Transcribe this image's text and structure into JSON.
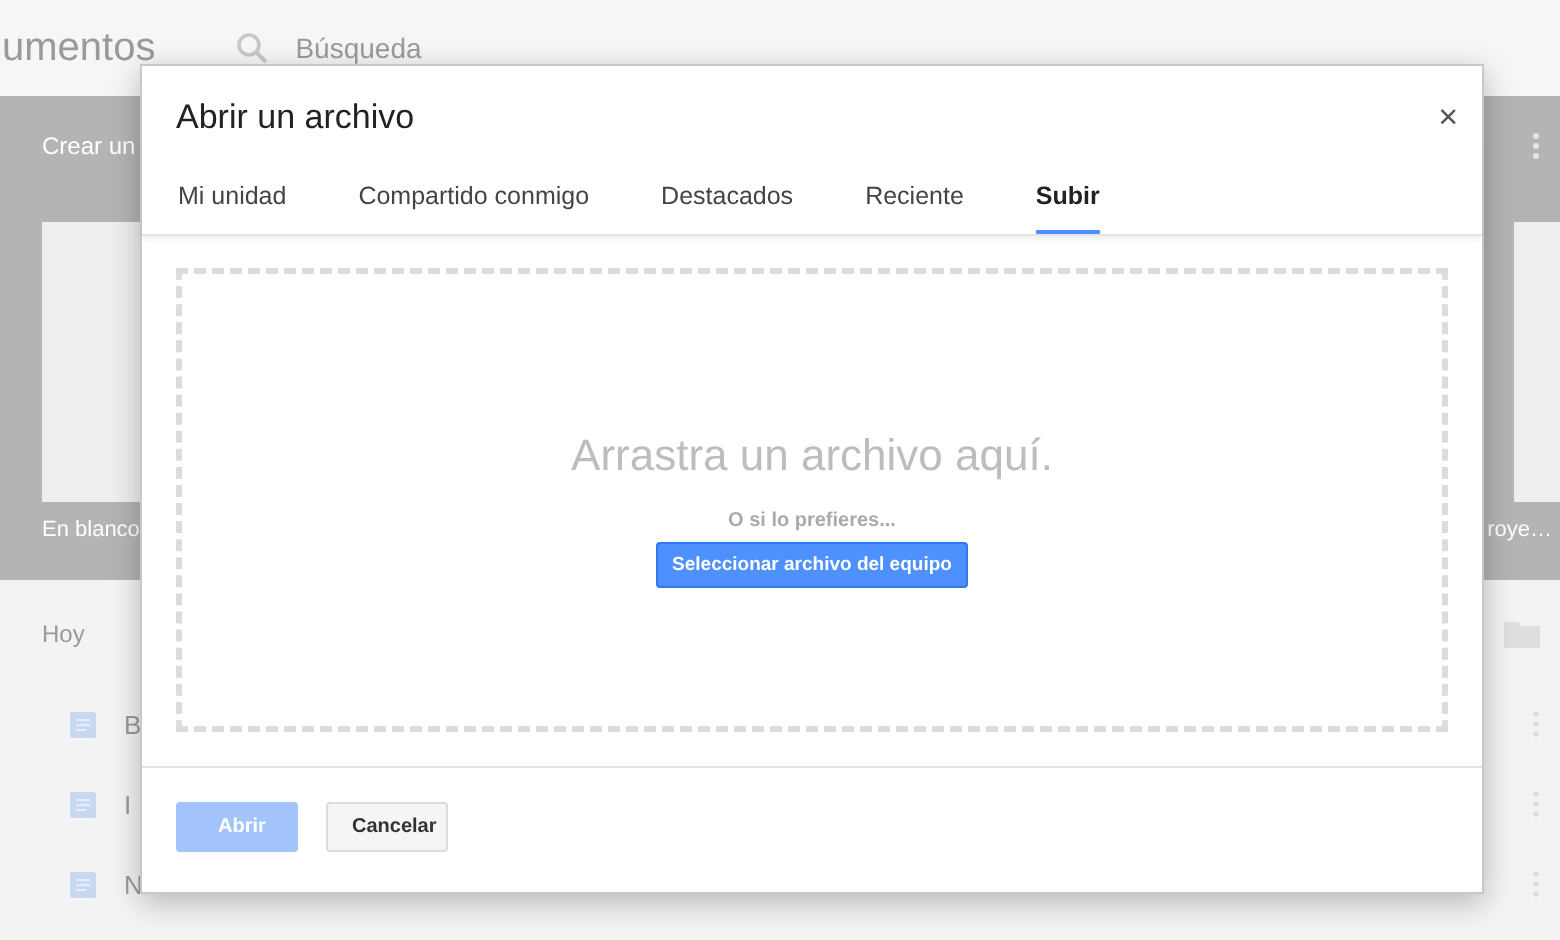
{
  "app": {
    "title": "umentos",
    "search": {
      "placeholder": "Búsqueda"
    }
  },
  "templates": {
    "heading": "Crear un",
    "items": [
      {
        "label": "En blanco"
      },
      {
        "label": "roye…"
      }
    ]
  },
  "recent": {
    "heading": "Hoy",
    "rows": [
      {
        "name": "B"
      },
      {
        "name": "I"
      },
      {
        "name": "N"
      }
    ]
  },
  "dialog": {
    "title": "Abrir un archivo",
    "close": "×",
    "tabs": [
      {
        "label": "Mi unidad",
        "selected": false
      },
      {
        "label": "Compartido conmigo",
        "selected": false
      },
      {
        "label": "Destacados",
        "selected": false
      },
      {
        "label": "Reciente",
        "selected": false
      },
      {
        "label": "Subir",
        "selected": true
      }
    ],
    "drop_zone": {
      "message": "Arrastra un archivo aquí.",
      "alternative": "O si lo prefieres...",
      "button": "Seleccionar archivo del equipo"
    },
    "buttons": [
      {
        "label": "Abrir",
        "kind": "primary",
        "disabled": true
      },
      {
        "label": "Cancelar",
        "kind": "secondary",
        "disabled": false
      }
    ]
  }
}
